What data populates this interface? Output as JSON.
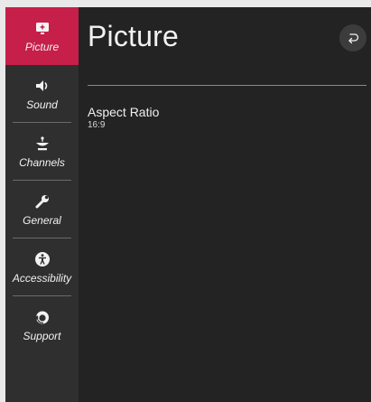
{
  "page": {
    "title": "Picture",
    "back_icon": "back-arrow-icon"
  },
  "sidebar": {
    "items": [
      {
        "label": "Picture",
        "icon": "tv-icon",
        "active": true
      },
      {
        "label": "Sound",
        "icon": "speaker-icon",
        "active": false
      },
      {
        "label": "Channels",
        "icon": "satellite-dish-icon",
        "active": false
      },
      {
        "label": "General",
        "icon": "wrench-icon",
        "active": false
      },
      {
        "label": "Accessibility",
        "icon": "accessibility-icon",
        "active": false
      },
      {
        "label": "Support",
        "icon": "headset-icon",
        "active": false
      }
    ]
  },
  "settings": [
    {
      "label": "Aspect Ratio",
      "value": "16:9"
    }
  ],
  "colors": {
    "accent": "#c51f4a",
    "sidebar": "#2f2f2f",
    "background": "#232323",
    "text": "#f2f2f2"
  }
}
